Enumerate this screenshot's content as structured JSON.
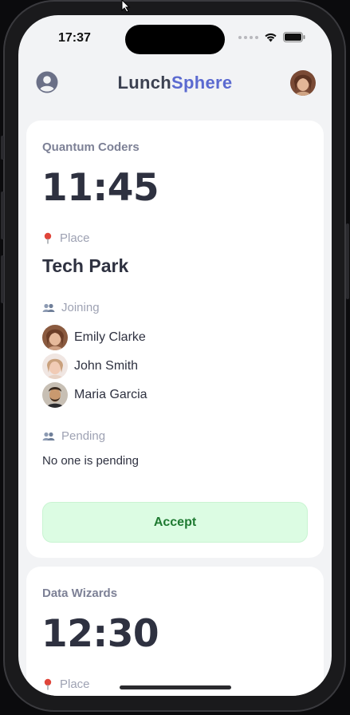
{
  "status_bar": {
    "time": "17:37"
  },
  "app": {
    "title_part1": "Lunch",
    "title_part2": "Sphere",
    "accent_color": "#5b6ad0"
  },
  "cards": [
    {
      "team": "Quantum Coders",
      "time": "11:45",
      "place_label": "Place",
      "place": "Tech Park",
      "joining_label": "Joining",
      "joining": [
        "Emily Clarke",
        "John Smith",
        "Maria Garcia"
      ],
      "pending_label": "Pending",
      "pending_text": "No one is pending",
      "accept_label": "Accept"
    },
    {
      "team": "Data Wizards",
      "time": "12:30",
      "place_label": "Place"
    }
  ],
  "colors": {
    "accept_bg": "#dcfce3",
    "accept_text": "#1f7a32",
    "place_pin": "#e0453a"
  }
}
